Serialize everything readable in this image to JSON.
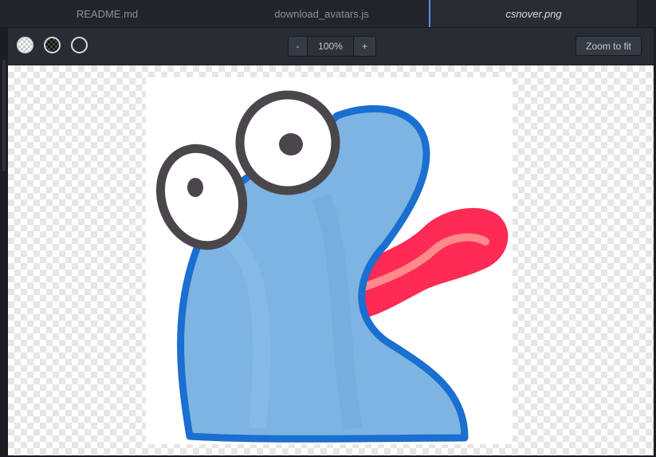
{
  "tabs": [
    {
      "label": "README.md",
      "active": false
    },
    {
      "label": "download_avatars.js",
      "active": false
    },
    {
      "label": "csnover.png",
      "active": true
    }
  ],
  "toolbar": {
    "background_options": [
      "transparent-light",
      "transparent-dark",
      "white"
    ],
    "zoom_out_label": "-",
    "zoom_level": "100%",
    "zoom_in_label": "+",
    "zoom_to_fit_label": "Zoom to fit"
  },
  "image": {
    "file_name": "csnover.png",
    "subject": "hand-drawn blue creature with googly eyes and red tongue"
  },
  "colors": {
    "accent": "#568af2",
    "body_blue": "#7db4e2",
    "outline_blue": "#1a6fd0",
    "tongue_red": "#ff2a55",
    "eye_outline": "#4a464c"
  }
}
